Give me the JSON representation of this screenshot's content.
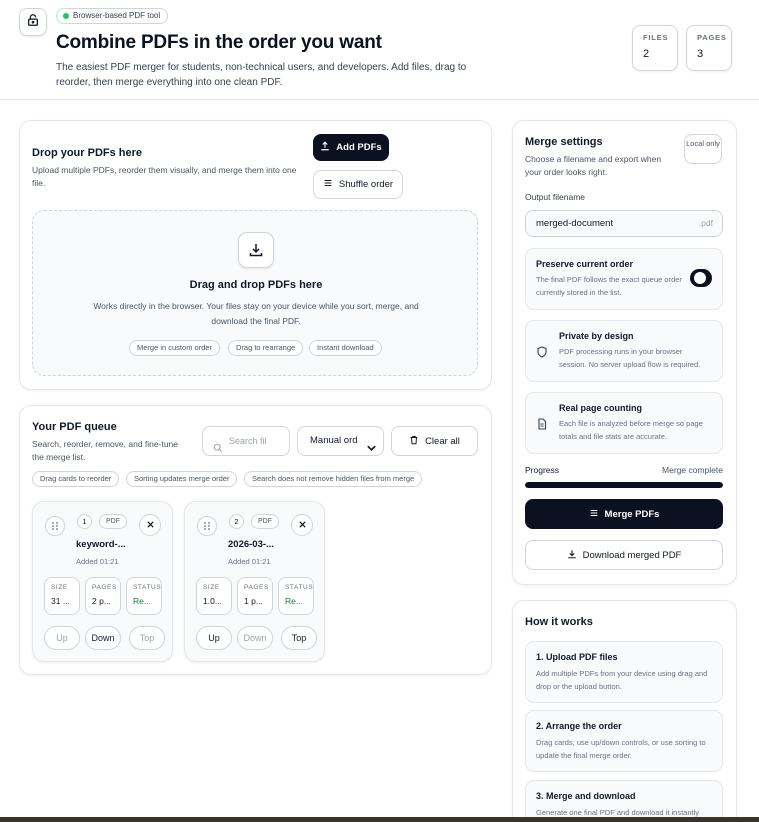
{
  "header": {
    "badge": "Browser-based PDF tool",
    "title": "Combine PDFs in the order you want",
    "subtitle": "The easiest PDF merger for students, non-technical users, and developers. Add files, drag to reorder, then merge everything into one clean PDF.",
    "stats": [
      {
        "label": "FILES",
        "value": "2"
      },
      {
        "label": "PAGES",
        "value": "3"
      }
    ]
  },
  "upload": {
    "title": "Drop your PDFs here",
    "description": "Upload multiple PDFs, reorder them visually, and merge them into one file.",
    "add_label": "Add PDFs",
    "shuffle_label": "Shuffle order",
    "dropzone": {
      "title": "Drag and drop PDFs here",
      "text": "Works directly in the browser. Your files stay on your device while you sort, merge, and download the final PDF.",
      "chips": [
        "Merge in custom order",
        "Drag to rearrange",
        "Instant download"
      ]
    }
  },
  "queue": {
    "title": "Your PDF queue",
    "description": "Search, reorder, remove, and fine-tune the merge list.",
    "search_placeholder": "Search fil",
    "sort_value": "Manual ord",
    "clear_label": "Clear all",
    "hints": [
      "Drag cards to reorder",
      "Sorting updates merge order",
      "Search does not remove hidden files from merge"
    ],
    "files": [
      {
        "index": "1",
        "type": "PDF",
        "name": "keyword-...",
        "added": "Added 01:21",
        "size_label": "SIZE",
        "size": "31 ...",
        "pages_label": "PAGES",
        "pages": "2 p...",
        "status_label": "STATUS",
        "status": "Re...",
        "up": "Up",
        "down": "Down",
        "top": "Top"
      },
      {
        "index": "2",
        "type": "PDF",
        "name": "2026-03-...",
        "added": "Added 01:21",
        "size_label": "SIZE",
        "size": "1.0...",
        "pages_label": "PAGES",
        "pages": "1 p...",
        "status_label": "STATUS",
        "status": "Re...",
        "up": "Up",
        "down": "Down",
        "top": "Top"
      }
    ]
  },
  "settings": {
    "title": "Merge settings",
    "description": "Choose a filename and export when your order looks right.",
    "badge": "Local only",
    "filename_label": "Output filename",
    "filename_value": "merged-document",
    "filename_suffix": ".pdf",
    "preserve": {
      "title": "Preserve current order",
      "desc": "The final PDF follows the exact queue order currently stored in the list.",
      "enabled": true
    },
    "privacy": {
      "title": "Private by design",
      "desc": "PDF processing runs in your browser session. No server upload flow is required."
    },
    "counting": {
      "title": "Real page counting",
      "desc": "Each file is analyzed before merge so page totals and file stats are accurate."
    },
    "progress_label": "Progress",
    "progress_status": "Merge complete",
    "progress_value": 1.0,
    "merge_label": "Merge PDFs",
    "download_label": "Download merged PDF"
  },
  "how": {
    "title": "How it works",
    "steps": [
      {
        "title": "1. Upload PDF files",
        "desc": "Add multiple PDFs from your device using drag and drop or the upload button."
      },
      {
        "title": "2. Arrange the order",
        "desc": "Drag cards, use up/down controls, or use sorting to update the final merge order."
      },
      {
        "title": "3. Merge and download",
        "desc": "Generate one final PDF and download it instantly"
      }
    ]
  },
  "colors": {
    "accent": "#0b1120",
    "status_ready": "#15803d",
    "badge_dot": "#22c55e"
  }
}
